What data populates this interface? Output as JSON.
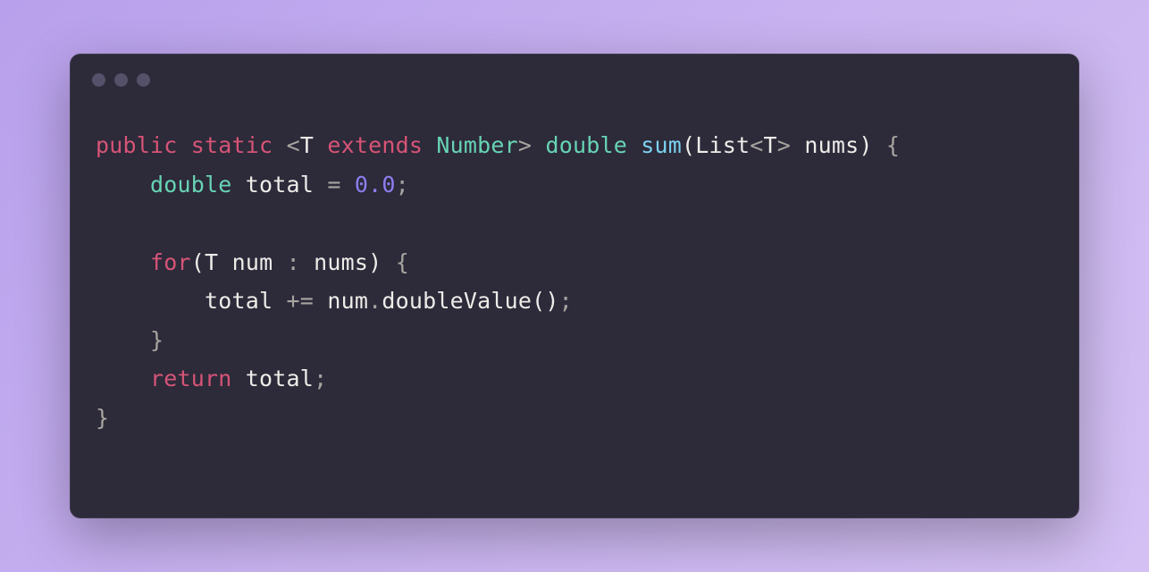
{
  "editor": {
    "colors": {
      "background_gradient_start": "#b8a0ec",
      "background_gradient_end": "#d4c0f3",
      "window_bg": "#2d2a3a",
      "window_border": "#403d4f",
      "traffic_light": "#55516a",
      "keyword": "#d65476",
      "type": "#67d4b4",
      "funcname": "#7bd2f0",
      "number": "#8b7fef",
      "text": "#eeece8",
      "punct": "#a8a5a0"
    },
    "traffic_lights": 3,
    "code_lines": [
      [
        {
          "t": "public",
          "c": "tok-keyword"
        },
        {
          "t": " ",
          "c": "tok-plain"
        },
        {
          "t": "static",
          "c": "tok-modifier"
        },
        {
          "t": " ",
          "c": "tok-plain"
        },
        {
          "t": "<",
          "c": "tok-angle"
        },
        {
          "t": "T",
          "c": "tok-plain"
        },
        {
          "t": " ",
          "c": "tok-plain"
        },
        {
          "t": "extends",
          "c": "tok-keyword"
        },
        {
          "t": " ",
          "c": "tok-plain"
        },
        {
          "t": "Number",
          "c": "tok-type"
        },
        {
          "t": ">",
          "c": "tok-angle"
        },
        {
          "t": " ",
          "c": "tok-plain"
        },
        {
          "t": "double",
          "c": "tok-type"
        },
        {
          "t": " ",
          "c": "tok-plain"
        },
        {
          "t": "sum",
          "c": "tok-funcname"
        },
        {
          "t": "(",
          "c": "tok-paren"
        },
        {
          "t": "List",
          "c": "tok-plain"
        },
        {
          "t": "<",
          "c": "tok-angle"
        },
        {
          "t": "T",
          "c": "tok-plain"
        },
        {
          "t": ">",
          "c": "tok-angle"
        },
        {
          "t": " ",
          "c": "tok-plain"
        },
        {
          "t": "nums",
          "c": "tok-ident"
        },
        {
          "t": ")",
          "c": "tok-paren"
        },
        {
          "t": " ",
          "c": "tok-plain"
        },
        {
          "t": "{",
          "c": "tok-brace"
        }
      ],
      [
        {
          "t": "    ",
          "c": "tok-plain"
        },
        {
          "t": "double",
          "c": "tok-type"
        },
        {
          "t": " ",
          "c": "tok-plain"
        },
        {
          "t": "total",
          "c": "tok-ident"
        },
        {
          "t": " ",
          "c": "tok-plain"
        },
        {
          "t": "=",
          "c": "tok-op"
        },
        {
          "t": " ",
          "c": "tok-plain"
        },
        {
          "t": "0.0",
          "c": "tok-number"
        },
        {
          "t": ";",
          "c": "tok-punct"
        }
      ],
      [
        {
          "t": " ",
          "c": "tok-plain"
        }
      ],
      [
        {
          "t": "    ",
          "c": "tok-plain"
        },
        {
          "t": "for",
          "c": "tok-keyword"
        },
        {
          "t": "(",
          "c": "tok-paren"
        },
        {
          "t": "T",
          "c": "tok-plain"
        },
        {
          "t": " ",
          "c": "tok-plain"
        },
        {
          "t": "num",
          "c": "tok-ident"
        },
        {
          "t": " ",
          "c": "tok-plain"
        },
        {
          "t": ":",
          "c": "tok-op"
        },
        {
          "t": " ",
          "c": "tok-plain"
        },
        {
          "t": "nums",
          "c": "tok-ident"
        },
        {
          "t": ")",
          "c": "tok-paren"
        },
        {
          "t": " ",
          "c": "tok-plain"
        },
        {
          "t": "{",
          "c": "tok-brace"
        }
      ],
      [
        {
          "t": "        ",
          "c": "tok-plain"
        },
        {
          "t": "total",
          "c": "tok-ident"
        },
        {
          "t": " ",
          "c": "tok-plain"
        },
        {
          "t": "+=",
          "c": "tok-op"
        },
        {
          "t": " ",
          "c": "tok-plain"
        },
        {
          "t": "num",
          "c": "tok-ident"
        },
        {
          "t": ".",
          "c": "tok-punct"
        },
        {
          "t": "doubleValue",
          "c": "tok-method"
        },
        {
          "t": "(",
          "c": "tok-paren"
        },
        {
          "t": ")",
          "c": "tok-paren"
        },
        {
          "t": ";",
          "c": "tok-punct"
        }
      ],
      [
        {
          "t": "    ",
          "c": "tok-plain"
        },
        {
          "t": "}",
          "c": "tok-brace"
        }
      ],
      [
        {
          "t": "    ",
          "c": "tok-plain"
        },
        {
          "t": "return",
          "c": "tok-keyword"
        },
        {
          "t": " ",
          "c": "tok-plain"
        },
        {
          "t": "total",
          "c": "tok-ident"
        },
        {
          "t": ";",
          "c": "tok-punct"
        }
      ],
      [
        {
          "t": "}",
          "c": "tok-brace"
        }
      ]
    ]
  }
}
